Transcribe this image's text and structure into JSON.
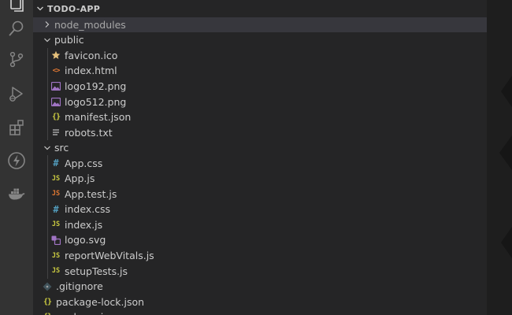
{
  "explorer": {
    "project_title": "TODO-APP"
  },
  "activity_bar": [
    {
      "name": "explorer-icon"
    },
    {
      "name": "search-icon"
    },
    {
      "name": "source-control-icon"
    },
    {
      "name": "run-debug-icon"
    },
    {
      "name": "extensions-icon"
    },
    {
      "name": "remote-lightning-icon"
    },
    {
      "name": "docker-icon"
    }
  ],
  "tree": [
    {
      "label": "node_modules",
      "type": "folder",
      "expanded": false,
      "depth": 0,
      "selected": true
    },
    {
      "label": "public",
      "type": "folder",
      "expanded": true,
      "depth": 0
    },
    {
      "label": "favicon.ico",
      "type": "file",
      "icon": "star-icon",
      "icon_color": "#e5c07b",
      "depth": 1
    },
    {
      "label": "index.html",
      "type": "file",
      "icon": "html-icon",
      "icon_color": "#e37933",
      "depth": 1
    },
    {
      "label": "logo192.png",
      "type": "file",
      "icon": "image-icon",
      "icon_color": "#a074c4",
      "depth": 1
    },
    {
      "label": "logo512.png",
      "type": "file",
      "icon": "image-icon",
      "icon_color": "#a074c4",
      "depth": 1
    },
    {
      "label": "manifest.json",
      "type": "file",
      "icon": "json-icon",
      "icon_color": "#cbcb41",
      "depth": 1
    },
    {
      "label": "robots.txt",
      "type": "file",
      "icon": "text-icon",
      "icon_color": "#c5c5c5",
      "depth": 1
    },
    {
      "label": "src",
      "type": "folder",
      "expanded": true,
      "depth": 0
    },
    {
      "label": "App.css",
      "type": "file",
      "icon": "css-icon",
      "icon_color": "#519aba",
      "depth": 1
    },
    {
      "label": "App.js",
      "type": "file",
      "icon": "js-icon",
      "icon_color": "#cbcb41",
      "depth": 1
    },
    {
      "label": "App.test.js",
      "type": "file",
      "icon": "js-test-icon",
      "icon_color": "#e37933",
      "depth": 1
    },
    {
      "label": "index.css",
      "type": "file",
      "icon": "css-icon",
      "icon_color": "#519aba",
      "depth": 1
    },
    {
      "label": "index.js",
      "type": "file",
      "icon": "js-icon",
      "icon_color": "#cbcb41",
      "depth": 1
    },
    {
      "label": "logo.svg",
      "type": "file",
      "icon": "svg-icon",
      "icon_color": "#a074c4",
      "depth": 1
    },
    {
      "label": "reportWebVitals.js",
      "type": "file",
      "icon": "js-icon",
      "icon_color": "#cbcb41",
      "depth": 1
    },
    {
      "label": "setupTests.js",
      "type": "file",
      "icon": "js-icon",
      "icon_color": "#cbcb41",
      "depth": 1
    },
    {
      "label": ".gitignore",
      "type": "file",
      "icon": "git-icon",
      "icon_color": "#41535b",
      "depth": 0
    },
    {
      "label": "package-lock.json",
      "type": "file",
      "icon": "json-icon",
      "icon_color": "#cbcb41",
      "depth": 0
    },
    {
      "label": "package.json",
      "type": "file",
      "icon": "json-icon",
      "icon_color": "#cbcb41",
      "depth": 0
    }
  ],
  "glyphs": {
    "js": "JS",
    "css": "#",
    "json": "{}",
    "html": "<>"
  },
  "colors": {
    "activity_bar_bg": "#333333",
    "sidebar_bg": "#252526",
    "selected_row_bg": "#37373d",
    "editor_bg": "#1e1e1e",
    "text": "#cccccc"
  }
}
